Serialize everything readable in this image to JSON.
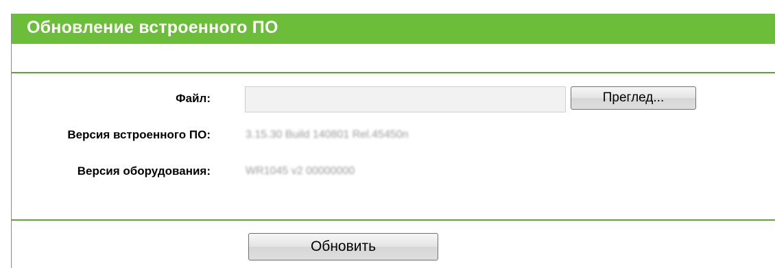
{
  "header": {
    "title": "Обновление встроенного ПО"
  },
  "form": {
    "file_label": "Файл:",
    "file_value": "",
    "browse_label": "Преглед...",
    "firmware_label": "Версия встроенного ПО:",
    "firmware_value": "3.15.30 Build 140801 Rel.45450n",
    "hardware_label": "Версия оборудования:",
    "hardware_value": "WR1045 v2 00000000"
  },
  "actions": {
    "update_label": "Обновить"
  },
  "colors": {
    "accent": "#6bbd3a",
    "divider": "#5aa832"
  }
}
